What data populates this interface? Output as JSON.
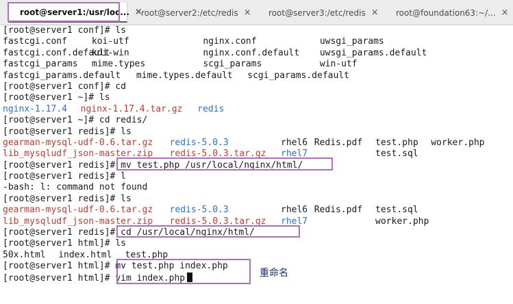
{
  "tabs": [
    {
      "label": "root@server1:/usr/loc...",
      "close": "×",
      "active": true
    },
    {
      "label": "root@server2:/etc/redis",
      "close": "×",
      "active": false
    },
    {
      "label": "root@server3:/etc/redis",
      "close": "×",
      "active": false
    },
    {
      "label": "root@foundation63:~/...",
      "close": "×",
      "active": false
    }
  ],
  "terminal": {
    "lines": [
      [
        {
          "t": "[root@server1 conf]# ls"
        }
      ],
      [
        {
          "t": "fastcgi.conf"
        },
        {
          "t": "koi-utf",
          "c": 16
        },
        {
          "t": "nginx.conf",
          "c": 36
        },
        {
          "t": "uwsgi_params",
          "c": 57
        }
      ],
      [
        {
          "t": "fastcgi.conf.default"
        },
        {
          "t": "koi-win",
          "c": 16
        },
        {
          "t": "nginx.conf.default",
          "c": 36
        },
        {
          "t": "uwsgi_params.default",
          "c": 57
        }
      ],
      [
        {
          "t": "fastcgi_params"
        },
        {
          "t": "mime.types",
          "c": 16
        },
        {
          "t": "scgi_params",
          "c": 36
        },
        {
          "t": "win-utf",
          "c": 57
        }
      ],
      [
        {
          "t": "fastcgi_params.default"
        },
        {
          "t": "mime.types.default",
          "c": 24
        },
        {
          "t": "scgi_params.default",
          "c": 44
        }
      ],
      [
        {
          "t": "[root@server1 conf]# cd"
        }
      ],
      [
        {
          "t": "[root@server1 ~]# ls"
        }
      ],
      [
        {
          "t": "nginx-1.17.4",
          "k": "blue"
        },
        {
          "t": "nginx-1.17.4.tar.gz",
          "k": "red",
          "c": 14
        },
        {
          "t": "redis",
          "k": "blue",
          "c": 35
        }
      ],
      [
        {
          "t": "[root@server1 ~]# cd redis/"
        }
      ],
      [
        {
          "t": "[root@server1 redis]# ls"
        }
      ],
      [
        {
          "t": "gearman-mysql-udf-0.6.tar.gz",
          "k": "red"
        },
        {
          "t": "redis-5.0.3",
          "k": "blue",
          "c": 30
        },
        {
          "t": "rhel6",
          "c": 50
        },
        {
          "t": "Redis.pdf",
          "c": 56
        },
        {
          "t": "test.php",
          "c": 67
        },
        {
          "t": "worker.php",
          "c": 77
        }
      ],
      [
        {
          "t": "lib_mysqludf_json-master.zip",
          "k": "red"
        },
        {
          "t": "redis-5.0.3.tar.gz",
          "k": "red",
          "c": 30
        },
        {
          "t": "rhel7",
          "k": "blue",
          "c": 50
        },
        {
          "t": "test.sql",
          "c": 67
        }
      ],
      [
        {
          "t": "[root@server1 redis]# mv test.php /usr/local/nginx/html/"
        }
      ],
      [
        {
          "t": "[root@server1 redis]# l"
        }
      ],
      [
        {
          "t": "-bash: l: command not found"
        }
      ],
      [
        {
          "t": "[root@server1 redis]# ls"
        }
      ],
      [
        {
          "t": "gearman-mysql-udf-0.6.tar.gz",
          "k": "red"
        },
        {
          "t": "redis-5.0.3",
          "k": "blue",
          "c": 30
        },
        {
          "t": "rhel6",
          "c": 50
        },
        {
          "t": "Redis.pdf",
          "c": 56
        },
        {
          "t": "test.sql",
          "c": 67
        }
      ],
      [
        {
          "t": "lib_mysqludf_json-master.zip",
          "k": "red"
        },
        {
          "t": "redis-5.0.3.tar.gz",
          "k": "red",
          "c": 30
        },
        {
          "t": "rhel7",
          "k": "blue",
          "c": 50
        },
        {
          "t": "worker.php",
          "c": 67
        }
      ],
      [
        {
          "t": "[root@server1 redis]# cd /usr/local/nginx/html/"
        }
      ],
      [
        {
          "t": "[root@server1 html]# ls"
        }
      ],
      [
        {
          "t": "50x.html"
        },
        {
          "t": "index.html",
          "c": 10
        },
        {
          "t": "test.php",
          "c": 22
        }
      ],
      [
        {
          "t": "[root@server1 html]# mv test.php index.php"
        }
      ],
      [
        {
          "t": "[root@server1 html]# vim index.php"
        }
      ]
    ]
  },
  "annotation": "重命名",
  "colors": {
    "highlight_border": "#b56bc4",
    "red": "#c33b2f",
    "blue": "#2a6fd4",
    "annotation": "#1a2b7a"
  }
}
